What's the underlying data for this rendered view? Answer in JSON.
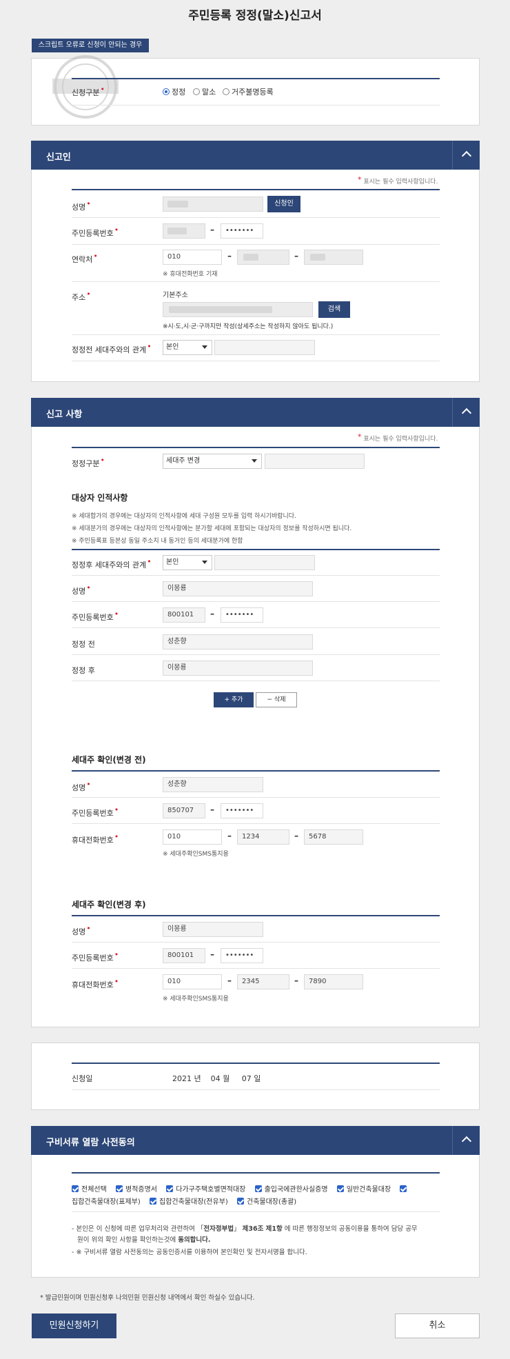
{
  "page_title": "주민등록 정정(말소)신고서",
  "script_error_button": "스크립트 오류로 신청이 안되는 경우",
  "apply_type": {
    "label": "신청구분",
    "options": [
      "정정",
      "말소",
      "거주불명등록"
    ],
    "selected": "정정"
  },
  "required_note": "표시는 필수 입력사항입니다.",
  "reporter": {
    "section_title": "신고인",
    "name_label": "성명",
    "applicant_button": "신청인",
    "rrn_label": "주민등록번호",
    "rrn_back": "•••••••",
    "contact_label": "연락처",
    "phone1": "010",
    "phone_note": "※ 휴대전화번호 기재",
    "address_label": "주소",
    "address_basic": "기본주소",
    "search_button": "검색",
    "address_note": "※시·도,시·군·구까지만 작성(상세주소는 작성하지 않아도 됩니다.)",
    "relation_label": "정정전 세대주와의 관계",
    "relation_value": "본인"
  },
  "report": {
    "section_title": "신고 사항",
    "correction_type_label": "정정구분",
    "correction_type_value": "세대주 변경",
    "target_heading": "대상자 인적사항",
    "notes": [
      "※ 세대합가의 경우에는 대상자의 인적사항에 세대 구성원 모두를 입력 하시기바랍니다.",
      "※ 세대분가의 경우에는 대상자의 인적사항에는 분가할 세대에 포함되는 대상자의 정보를 작성하시면 됩니다.",
      "※ 주민등록표 등본상 동일 주소지 내 동거인 등의 세대분가에 한함"
    ],
    "after_relation_label": "정정후 세대주와의 관계",
    "after_relation_value": "본인",
    "name_label": "성명",
    "name_value": "이몽룡",
    "rrn_label": "주민등록번호",
    "rrn_front": "800101",
    "rrn_back": "•••••••",
    "before_label": "정정 전",
    "before_value": "성춘향",
    "after_label": "정정 후",
    "after_value": "이몽룡",
    "add_button": "+ 추가",
    "delete_button": "− 삭제"
  },
  "head_before": {
    "heading": "세대주 확인(변경 전)",
    "name_label": "성명",
    "name_value": "성춘향",
    "rrn_label": "주민등록번호",
    "rrn_front": "850707",
    "rrn_back": "•••••••",
    "phone_label": "휴대전화번호",
    "phone1": "010",
    "phone2": "1234",
    "phone3": "5678",
    "sms_note": "※ 세대주확인SMS통지용"
  },
  "head_after": {
    "heading": "세대주 확인(변경 후)",
    "name_label": "성명",
    "name_value": "이몽룡",
    "rrn_label": "주민등록번호",
    "rrn_front": "800101",
    "rrn_back": "•••••••",
    "phone_label": "휴대전화번호",
    "phone1": "010",
    "phone2": "2345",
    "phone3": "7890",
    "sms_note": "※ 세대주확인SMS통지용"
  },
  "apply_date": {
    "label": "신청일",
    "year": "2021",
    "year_unit": "년",
    "month": "04",
    "month_unit": "월",
    "day": "07",
    "day_unit": "일"
  },
  "consent": {
    "section_title": "구비서류 열람 사전동의",
    "items_line1": [
      "전체선택",
      "병적증명서",
      "다가구주택호별면적대장",
      "출입국에관한사실증명",
      "일반건축물대장"
    ],
    "items_line2": [
      "집합건축물대장(표제부)",
      "집합건축물대장(전유부)",
      "건축물대장(총괄)"
    ],
    "text1_a": "- 본인은 이 신청에 따른 업무처리와 관련하여 「",
    "text1_law": "전자정부법",
    "text1_b": "」 ",
    "text1_art": "제36조 제1항",
    "text1_c": " 에 따른 행정정보의 공동이용을 통하여 담당 공무",
    "text1_d": "원이 위의 확인 사항을 확인하는것에 ",
    "text1_agree": "동의합니다.",
    "text2": "- ※ 구비서류 열람 사전동의는 공동인증서를 이용하여 본인확인 및 전자서명을 합니다."
  },
  "footer_note": "* 발급민원이며 민원신청후 나의민원 민원신청 내역에서 확인 하실수 있습니다.",
  "submit_button": "민원신청하기",
  "cancel_button": "취소",
  "colors": {
    "navy": "#2c4677",
    "required": "#d6202a",
    "check": "#2a63c9"
  }
}
